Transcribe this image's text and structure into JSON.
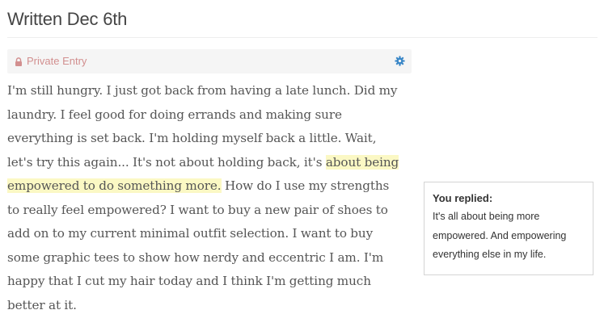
{
  "header": {
    "title": "Written Dec 6th"
  },
  "entry_bar": {
    "privacy_label": "Private Entry",
    "privacy_color": "#d28f8f",
    "settings_icon": "gear-icon",
    "lock_icon": "lock-icon"
  },
  "entry": {
    "text_before": "I'm still hungry. I just got back from having a late lunch. Did my laundry. I feel good for doing errands and making sure everything is set back. I'm holding myself back a little. Wait, let's try this again... It's not about holding back, it's ",
    "highlighted": "about being empowered to do something more.",
    "text_after": " How do I use my strengths to really feel empowered? I want to buy a new pair of shoes to add on to my current minimal outfit selection. I want to buy some graphic tees to show how nerdy and eccentric I am. I'm happy that I cut my hair today and I think I'm getting much better at it."
  },
  "reply": {
    "title": "You replied:",
    "text": "It's all about being more empowered. And empowering everything else in my life."
  }
}
